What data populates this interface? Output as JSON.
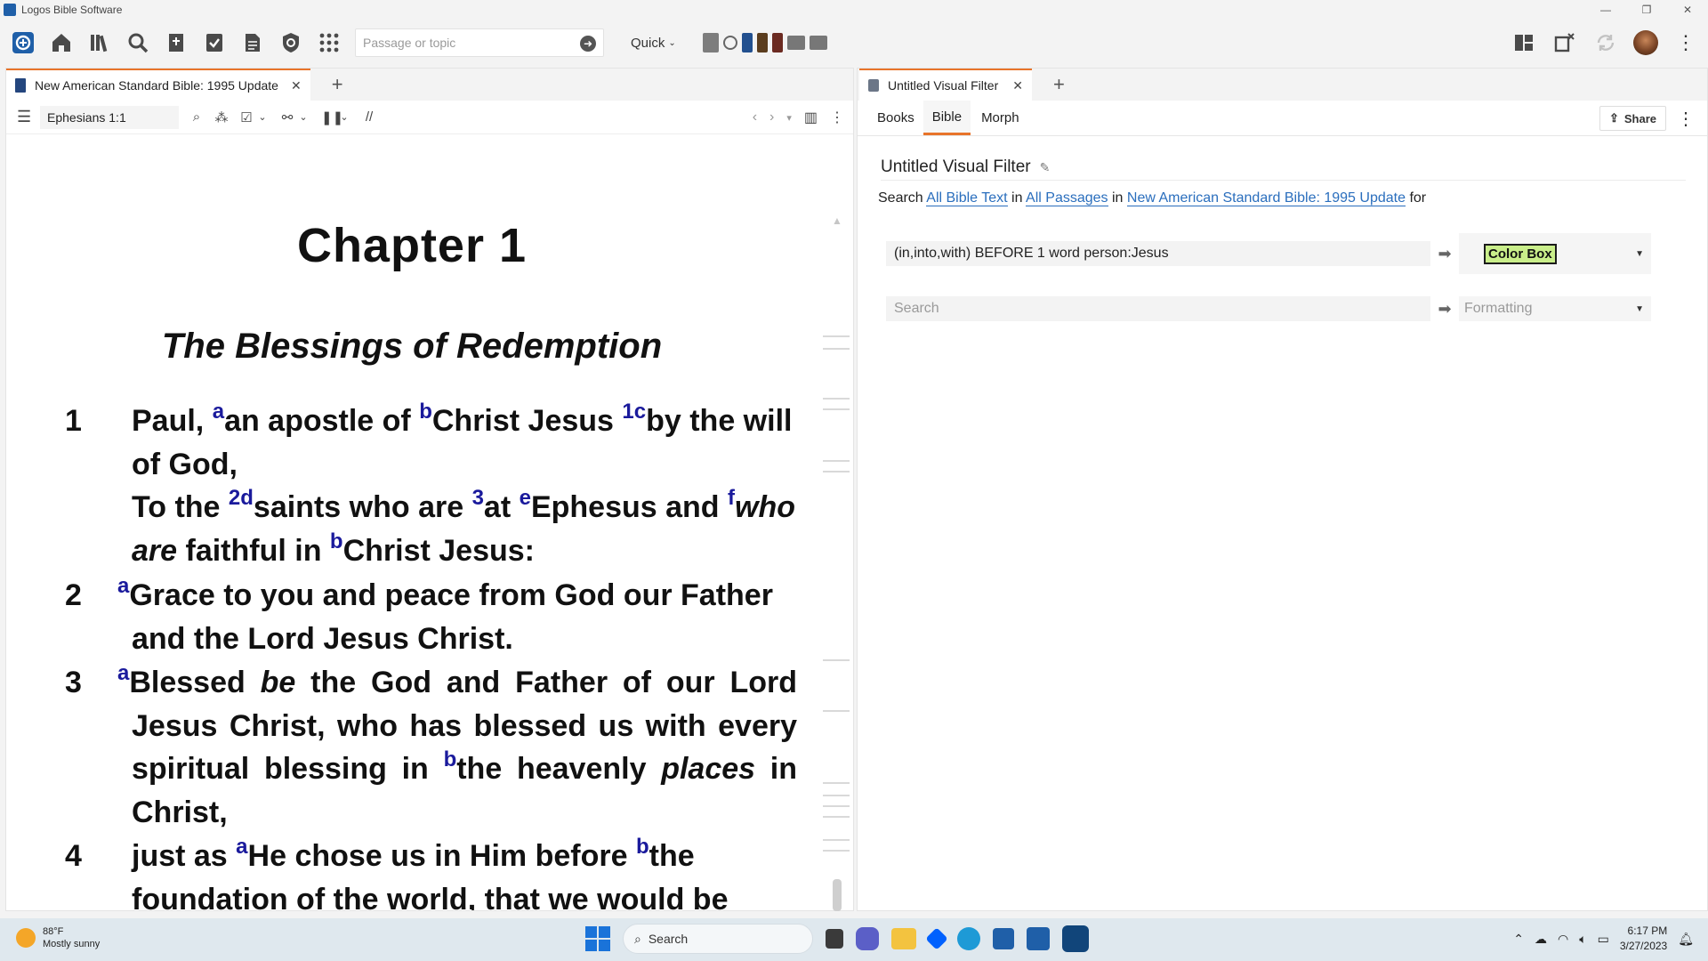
{
  "app": {
    "title": "Logos Bible Software"
  },
  "window_controls": {
    "minimize": "—",
    "restore": "❐",
    "close": "✕"
  },
  "toolbar": {
    "search_placeholder": "Passage or topic",
    "quick_label": "Quick",
    "icons": [
      "logos-icon",
      "home-icon",
      "library-icon",
      "search-icon",
      "guides-icon",
      "documents-icon",
      "notes-icon",
      "tools-icon",
      "apps-grid-icon"
    ],
    "right_icons": [
      "layouts-icon",
      "panels-icon",
      "sync-icon"
    ]
  },
  "left_panel": {
    "tab_title": "New American Standard Bible: 1995 Update",
    "tab_close": "✕",
    "tab_add": "+",
    "reference": "Ephesians 1:1",
    "chapter_title": "Chapter 1",
    "pericope": "The Blessings of Redemption",
    "verse_numbers": [
      "1",
      "2",
      "3",
      "4"
    ]
  },
  "right_panel": {
    "tab_title": "Untitled Visual Filter",
    "tab_close": "✕",
    "tab_add": "+",
    "subnav": [
      "Books",
      "Bible",
      "Morph"
    ],
    "active_subnav": "Bible",
    "share_label": "Share",
    "filter_title": "Untitled Visual Filter",
    "search_line": {
      "search": "Search",
      "scope_text": "All Bible Text",
      "in1": "in",
      "scope_passages": "All Passages",
      "in2": "in",
      "resource": "New American Standard Bible: 1995 Update",
      "for": "for"
    },
    "rules": [
      {
        "query": "(in,into,with) BEFORE 1 word person:Jesus",
        "format": "Color Box"
      }
    ],
    "new_rule": {
      "query_placeholder": "Search",
      "format_placeholder": "Formatting"
    }
  },
  "taskbar": {
    "weather_temp": "88°F",
    "weather_desc": "Mostly sunny",
    "search_label": "Search",
    "time": "6:17 PM",
    "date": "3/27/2023"
  },
  "colors": {
    "accent": "#e8742a",
    "link": "#2a6ebd",
    "footnote": "#1a1a9c",
    "color_box_fill": "#c9ee8a"
  }
}
